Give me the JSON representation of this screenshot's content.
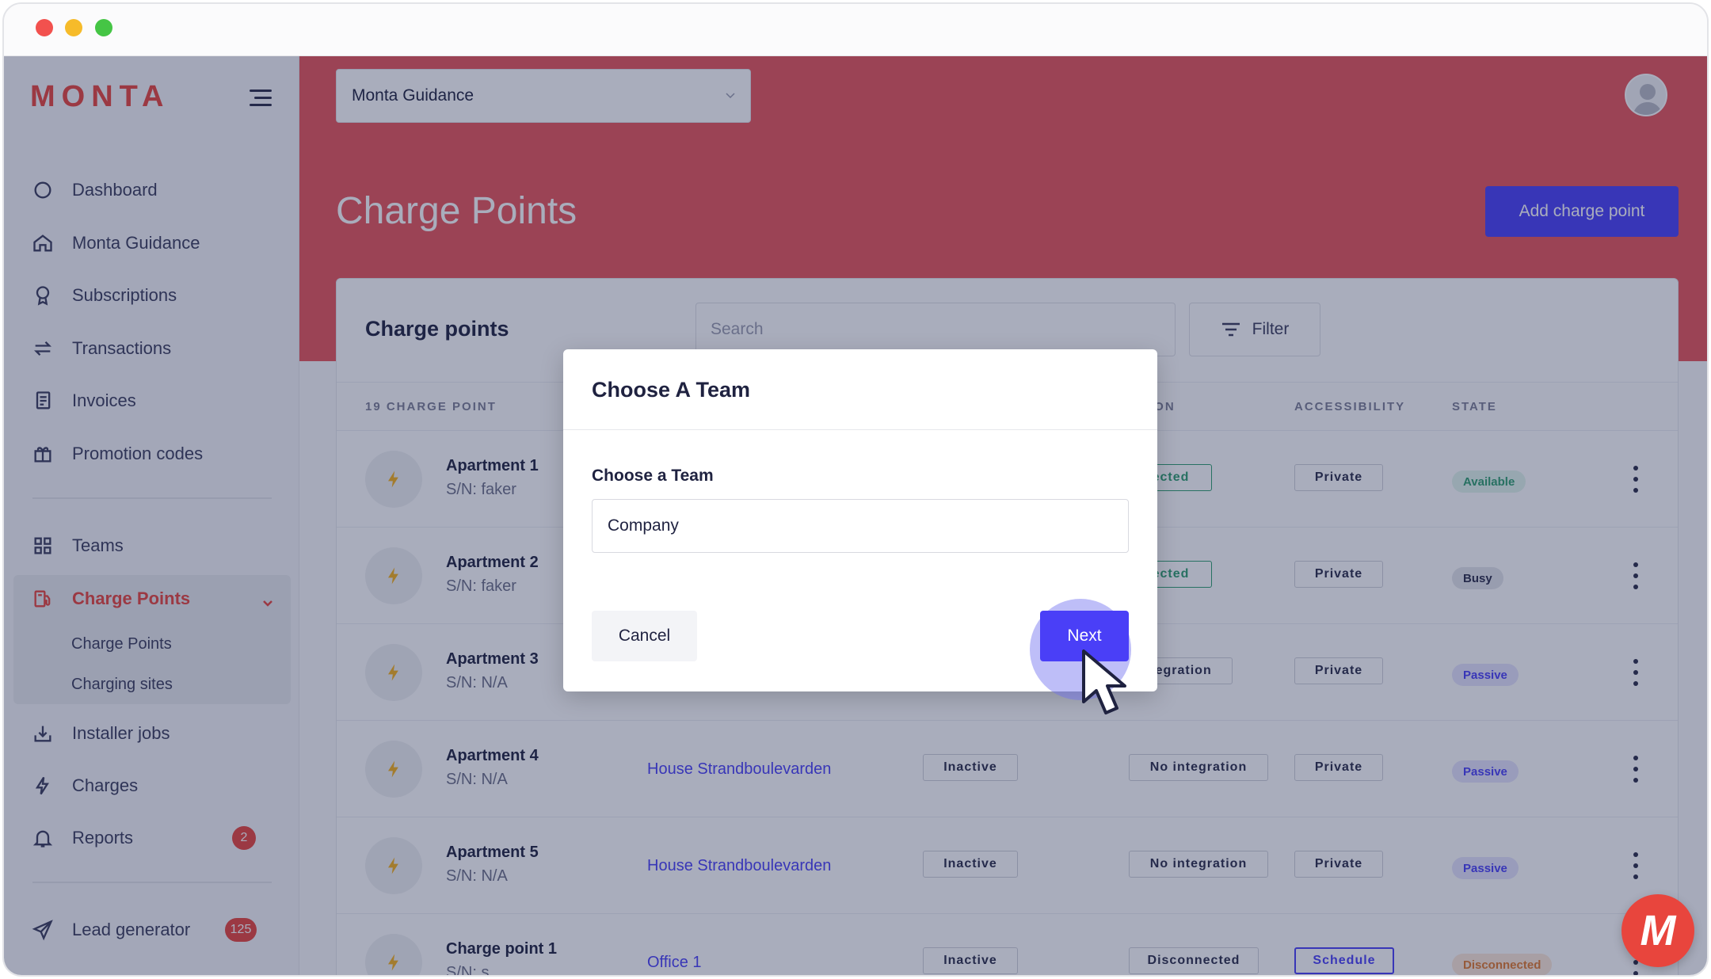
{
  "brand": {
    "logo_text": "MONTA",
    "accent": "#e8453d",
    "primary": "#4a3ff7"
  },
  "header": {
    "team_select_value": "Monta Guidance",
    "page_title": "Charge Points",
    "add_button": "Add charge point"
  },
  "sidebar": {
    "items": [
      {
        "label": "Dashboard",
        "icon": "dashboard-icon"
      },
      {
        "label": "Monta Guidance",
        "icon": "home-icon"
      },
      {
        "label": "Subscriptions",
        "icon": "badge-icon"
      },
      {
        "label": "Transactions",
        "icon": "transfer-icon"
      },
      {
        "label": "Invoices",
        "icon": "invoice-icon"
      },
      {
        "label": "Promotion codes",
        "icon": "gift-icon"
      },
      {
        "label": "Teams",
        "icon": "grid-icon"
      },
      {
        "label": "Charge Points",
        "icon": "charger-icon"
      },
      {
        "label": "Installer jobs",
        "icon": "download-icon"
      },
      {
        "label": "Charges",
        "icon": "bolt-icon"
      },
      {
        "label": "Reports",
        "icon": "bell-icon",
        "badge": "2"
      },
      {
        "label": "Lead generator",
        "icon": "send-icon",
        "badge": "125"
      }
    ],
    "sub_items": [
      "Charge Points",
      "Charging sites"
    ]
  },
  "card": {
    "title": "Charge points",
    "search_placeholder": "Search",
    "filter_label": "Filter",
    "columns": {
      "count": "19 CHARGE POINT",
      "connection": "CTION",
      "accessibility": "ACCESSIBILITY",
      "state": "STATE"
    },
    "rows": [
      {
        "name": "Apartment 1",
        "sn": "S/N: faker",
        "site": "",
        "status": "",
        "connection": "ected",
        "access": "Private",
        "state": "Available"
      },
      {
        "name": "Apartment 2",
        "sn": "S/N: faker",
        "site": "",
        "status": "",
        "connection": "ected",
        "access": "Private",
        "state": "Busy"
      },
      {
        "name": "Apartment 3",
        "sn": "S/N: N/A",
        "site": "",
        "status": "",
        "connection": "tegration",
        "access": "Private",
        "state": "Passive"
      },
      {
        "name": "Apartment 4",
        "sn": "S/N: N/A",
        "site": "House Strandboulevarden",
        "status": "Inactive",
        "connection": "No integration",
        "access": "Private",
        "state": "Passive"
      },
      {
        "name": "Apartment 5",
        "sn": "S/N: N/A",
        "site": "House Strandboulevarden",
        "status": "Inactive",
        "connection": "No integration",
        "access": "Private",
        "state": "Passive"
      },
      {
        "name": "Charge point 1",
        "sn": "S/N: s",
        "site": "Office 1",
        "status": "Inactive",
        "connection": "Disconnected",
        "access": "Schedule",
        "state": "Disconnected"
      }
    ]
  },
  "modal": {
    "title": "Choose A Team",
    "field_label": "Choose a Team",
    "field_value": "Company",
    "cancel": "Cancel",
    "next": "Next"
  },
  "fab": {
    "label": "M"
  }
}
